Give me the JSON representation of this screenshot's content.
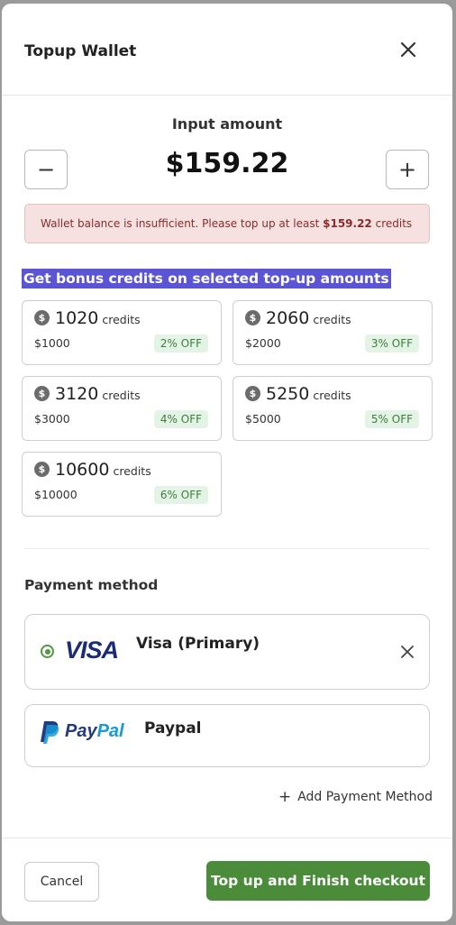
{
  "modal": {
    "title": "Topup Wallet"
  },
  "amount": {
    "label": "Input amount",
    "value": "$159.22",
    "decrement": "−",
    "increment": "+"
  },
  "alert": {
    "text_before": "Wallet balance is insufficient. Please top up at least ",
    "amount": "$159.22",
    "text_after": " credits"
  },
  "bonus": {
    "heading": "Get bonus credits on selected top-up amounts",
    "coin_symbol": "$",
    "credits_word": "credits",
    "options": [
      {
        "credits": "1020",
        "price": "$1000",
        "discount": "2% OFF"
      },
      {
        "credits": "2060",
        "price": "$2000",
        "discount": "3% OFF"
      },
      {
        "credits": "3120",
        "price": "$3000",
        "discount": "4% OFF"
      },
      {
        "credits": "5250",
        "price": "$5000",
        "discount": "5% OFF"
      },
      {
        "credits": "10600",
        "price": "$10000",
        "discount": "6% OFF"
      }
    ]
  },
  "payment": {
    "title": "Payment method",
    "methods": [
      {
        "name": "Visa (Primary)",
        "logo": "VISA",
        "selected": true,
        "icon": "visa-logo"
      },
      {
        "name": "Paypal",
        "logo_pay": "Pay",
        "logo_pal": "Pal",
        "selected": false,
        "icon": "paypal-logo"
      }
    ],
    "add_label": "Add Payment Method",
    "add_icon": "+"
  },
  "footer": {
    "cancel_label": "Cancel",
    "primary_label": "Top up and Finish checkout"
  },
  "colors": {
    "primary": "#4b8c3b",
    "alert_bg": "#f6e1e1",
    "alert_text": "#8a2a2a",
    "highlight": "#5b55d6",
    "discount_bg": "#e3f3e5"
  }
}
